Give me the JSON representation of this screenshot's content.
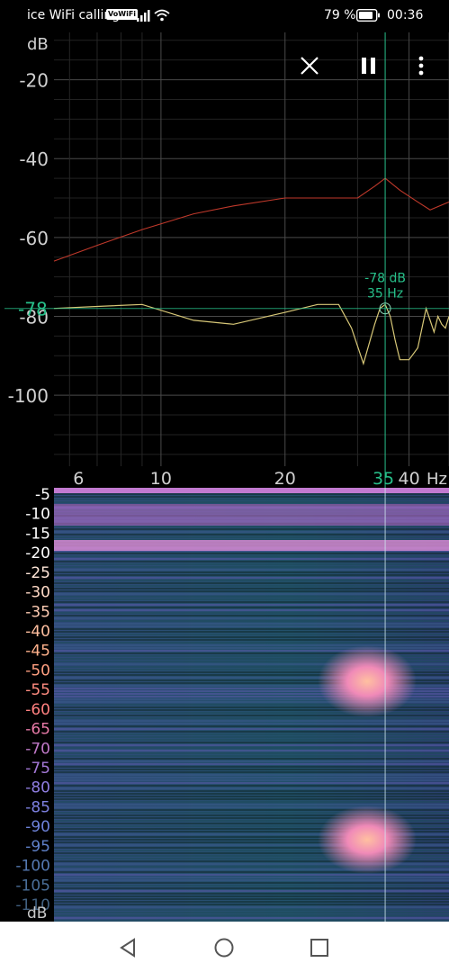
{
  "status": {
    "carrier": "ice WiFi calling",
    "volte_badge": "VoWiFi",
    "battery": "79 %",
    "time": "00:36"
  },
  "toolbar": {
    "close_icon": "close-icon",
    "pause_icon": "pause-icon",
    "menu_icon": "more-vertical-icon"
  },
  "spectrum": {
    "y_unit": "dB",
    "y_ticks": [
      "-20",
      "-40",
      "-60",
      "-80",
      "-100"
    ],
    "x_ticks": [
      "6",
      "10",
      "20",
      "40"
    ],
    "x_unit": "Hz",
    "cursor_label_x": "35",
    "cursor_level_label": "-78",
    "cursor_readout_db": "-78 dB",
    "cursor_readout_hz": "35 Hz",
    "colors": {
      "peak_line": "#c0392b",
      "current_line": "#d8c878",
      "cursor": "#27c08a",
      "grid": "#3a3a3a"
    }
  },
  "chart_data": {
    "type": "line",
    "x_scale": "log",
    "xlim": [
      5.5,
      50
    ],
    "ylim": [
      -118,
      -8
    ],
    "series": [
      {
        "x": [
          5.5,
          7,
          9,
          12,
          15,
          20,
          25,
          30,
          33,
          35,
          38,
          42,
          45,
          50
        ],
        "values": [
          -66,
          -62,
          -58,
          -54,
          -52,
          -50,
          -50,
          -50,
          -47,
          -45,
          -48,
          -51,
          -53,
          -51
        ]
      },
      {
        "x": [
          5.5,
          7,
          9,
          12,
          15,
          20,
          24,
          27,
          29,
          31,
          33,
          34,
          35,
          36,
          37,
          38,
          40,
          42,
          44,
          46,
          47,
          48,
          49,
          50
        ],
        "values": [
          -78,
          -77.5,
          -77,
          -81,
          -82,
          -79,
          -77,
          -77,
          -83,
          -92,
          -82,
          -78,
          -77,
          -80,
          -86,
          -91,
          -91,
          -88,
          -78,
          -84,
          -80,
          -82,
          -83,
          -80
        ]
      }
    ]
  },
  "spectrogram": {
    "y_ticks": [
      "-5",
      "-10",
      "-15",
      "-20",
      "-25",
      "-30",
      "-35",
      "-40",
      "-45",
      "-50",
      "-55",
      "-60",
      "-65",
      "-70",
      "-75",
      "-80",
      "-85",
      "-90",
      "-95",
      "-100",
      "-105",
      "-110"
    ],
    "y_unit": "dB",
    "tick_colors": [
      "#ffffff",
      "#ffffff",
      "#ffffff",
      "#ffffff",
      "#ffe6d8",
      "#ffd9c6",
      "#ffccb3",
      "#ffbf9f",
      "#ffb28c",
      "#ff9f80",
      "#ff8c80",
      "#ff8080",
      "#e87aa8",
      "#c079c8",
      "#a579d8",
      "#8f7de0",
      "#7d80e0",
      "#6d82d8",
      "#5f80c8",
      "#5478b0",
      "#4a6e98",
      "#416080"
    ]
  },
  "nav": {
    "back_icon": "back-triangle-icon",
    "home_icon": "home-circle-icon",
    "recents_icon": "recents-square-icon"
  }
}
